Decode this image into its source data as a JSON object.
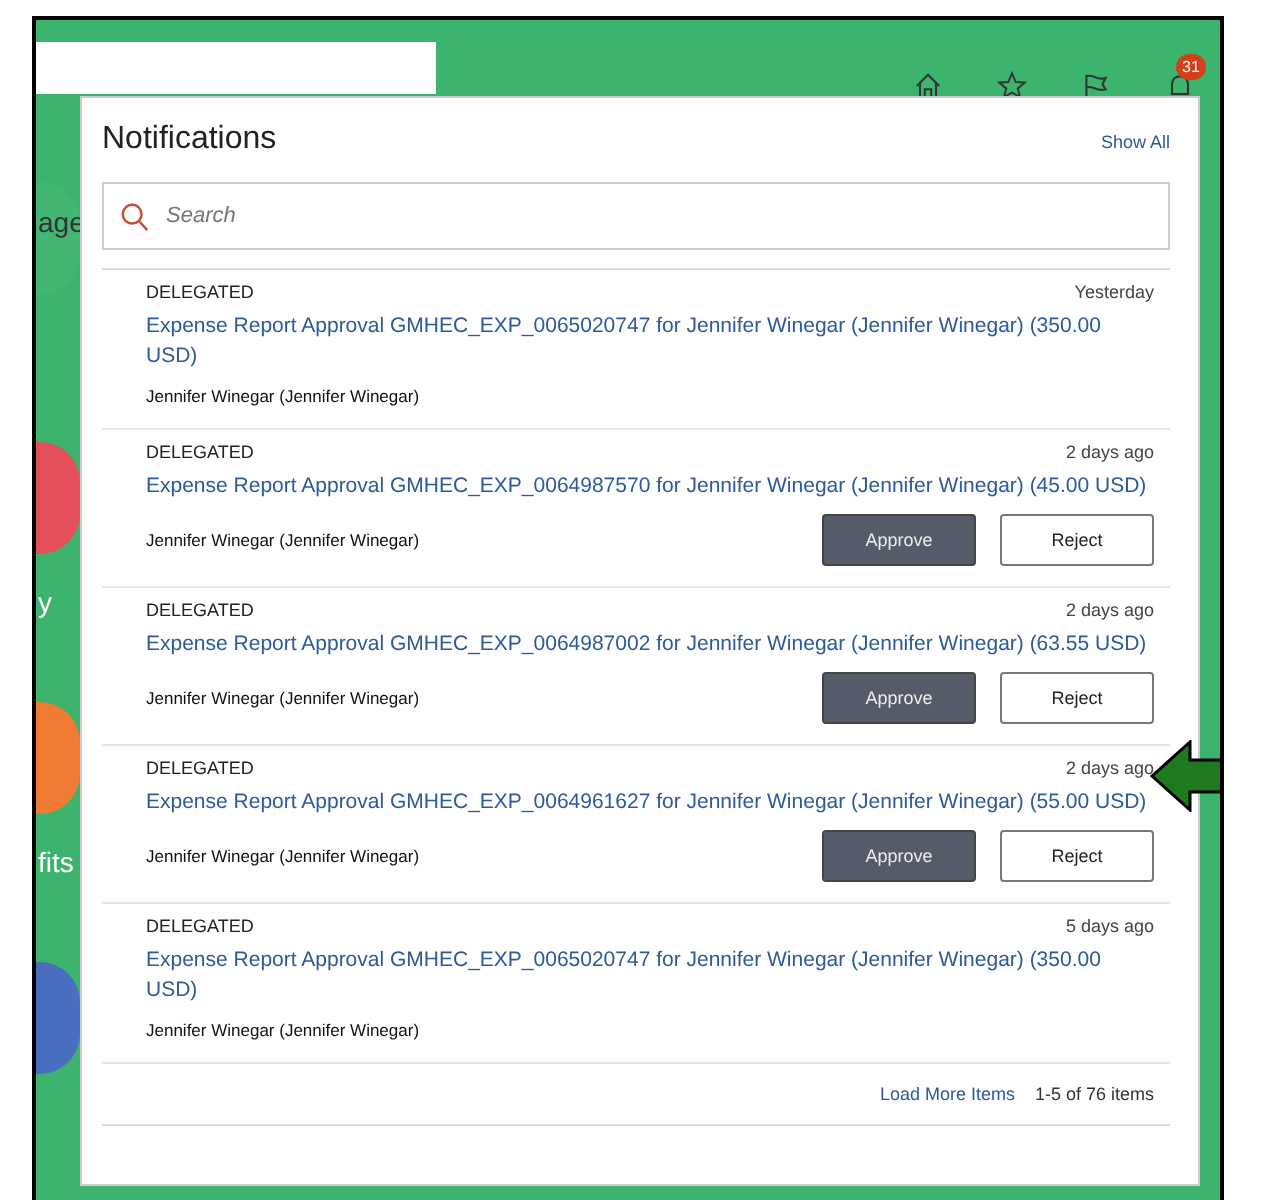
{
  "header": {
    "badge": "31"
  },
  "tiles": [
    {
      "label": "age",
      "color": "#4cb87a"
    },
    {
      "label": "y",
      "color": "#e5505a"
    },
    {
      "label": "fits",
      "color": "#f07b32"
    },
    {
      "color": "#4a6fc0"
    }
  ],
  "notifications": {
    "title": "Notifications",
    "show_all": "Show All",
    "search": {
      "placeholder": "Search"
    },
    "items": [
      {
        "status": "DELEGATED",
        "time": "Yesterday",
        "link": "Expense Report Approval GMHEC_EXP_0065020747 for Jennifer Winegar (Jennifer Winegar) (350.00 USD)",
        "from": "Jennifer Winegar (Jennifer Winegar)"
      },
      {
        "status": "DELEGATED",
        "time": "2 days ago",
        "link": "Expense Report Approval GMHEC_EXP_0064987570 for Jennifer Winegar (Jennifer Winegar) (45.00 USD)",
        "from": "Jennifer Winegar (Jennifer Winegar)",
        "buttons": [
          "Approve",
          "Reject"
        ]
      },
      {
        "status": "DELEGATED",
        "time": "2 days ago",
        "link": "Expense Report Approval GMHEC_EXP_0064987002 for Jennifer Winegar (Jennifer Winegar) (63.55 USD)",
        "from": "Jennifer Winegar (Jennifer Winegar)",
        "buttons": [
          "Approve",
          "Reject"
        ]
      },
      {
        "status": "DELEGATED",
        "time": "2 days ago",
        "link": "Expense Report Approval GMHEC_EXP_0064961627 for Jennifer Winegar (Jennifer Winegar) (55.00 USD)",
        "from": "Jennifer Winegar (Jennifer Winegar)",
        "buttons": [
          "Approve",
          "Reject"
        ]
      },
      {
        "status": "DELEGATED",
        "time": "5 days ago",
        "link": "Expense Report Approval GMHEC_EXP_0065020747 for Jennifer Winegar (Jennifer Winegar) (350.00 USD)",
        "from": "Jennifer Winegar (Jennifer Winegar)"
      }
    ],
    "load_more": "Load More Items",
    "count": "1-5 of 76 items"
  }
}
